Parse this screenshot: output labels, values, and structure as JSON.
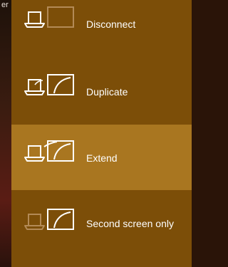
{
  "backdrop": {
    "text": "er"
  },
  "project": {
    "options": [
      {
        "key": "disconnect",
        "label": "Disconnect",
        "selected": false
      },
      {
        "key": "duplicate",
        "label": "Duplicate",
        "selected": false
      },
      {
        "key": "extend",
        "label": "Extend",
        "selected": true
      },
      {
        "key": "second-screen-only",
        "label": "Second screen only",
        "selected": false
      }
    ]
  }
}
